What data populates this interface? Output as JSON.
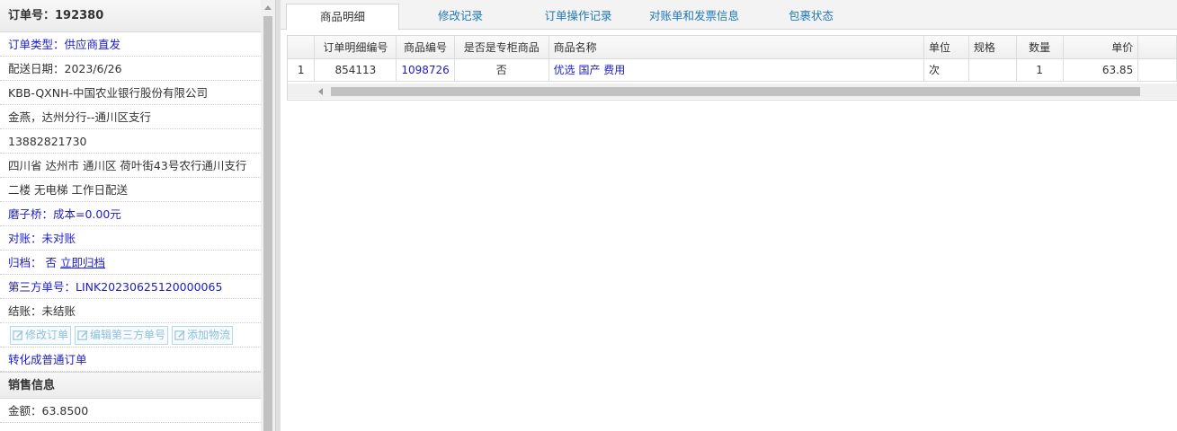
{
  "left": {
    "order_no": "订单号：192380",
    "rows": [
      {
        "text": "订单类型：供应商直发"
      },
      {
        "text": "配送日期：2023/6/26"
      },
      {
        "text": "KBB-QXNH-中国农业银行股份有限公司"
      },
      {
        "text": "金燕，达州分行--通川区支行"
      },
      {
        "text": "13882821730"
      },
      {
        "text": "四川省 达州市 通川区 荷叶街43号农行通川支行"
      },
      {
        "text": "二楼 无电梯 工作日配送"
      },
      {
        "text": "磨子桥：成本=0.00元"
      },
      {
        "text": "对账：未对账"
      }
    ],
    "archive_label": "归档：",
    "archive_value": "否",
    "archive_link": "立即归档",
    "third_party_no": "第三方单号：LINK20230625120000065",
    "settle": "结账：未结账",
    "buttons": {
      "edit_order": "修改订单",
      "edit_third": "编辑第三方单号",
      "add_logistics": "添加物流"
    },
    "convert_link": "转化成普通订单",
    "sales_header": "销售信息",
    "amount": "金额：63.8500"
  },
  "tabs": [
    "商品明细",
    "修改记录",
    "订单操作记录",
    "对账单和发票信息",
    "包裹状态"
  ],
  "grid": {
    "columns": [
      "订单明细编号",
      "商品编号",
      "是否是专柜商品",
      "商品名称",
      "单位",
      "规格",
      "数量",
      "单价"
    ],
    "rows": [
      {
        "index": "1",
        "detail_no": "854113",
        "goods_no": "1098726",
        "counter": "否",
        "name": "优选 国产 费用",
        "unit": "次",
        "spec": "",
        "qty": "1",
        "price": "63.85"
      }
    ]
  }
}
